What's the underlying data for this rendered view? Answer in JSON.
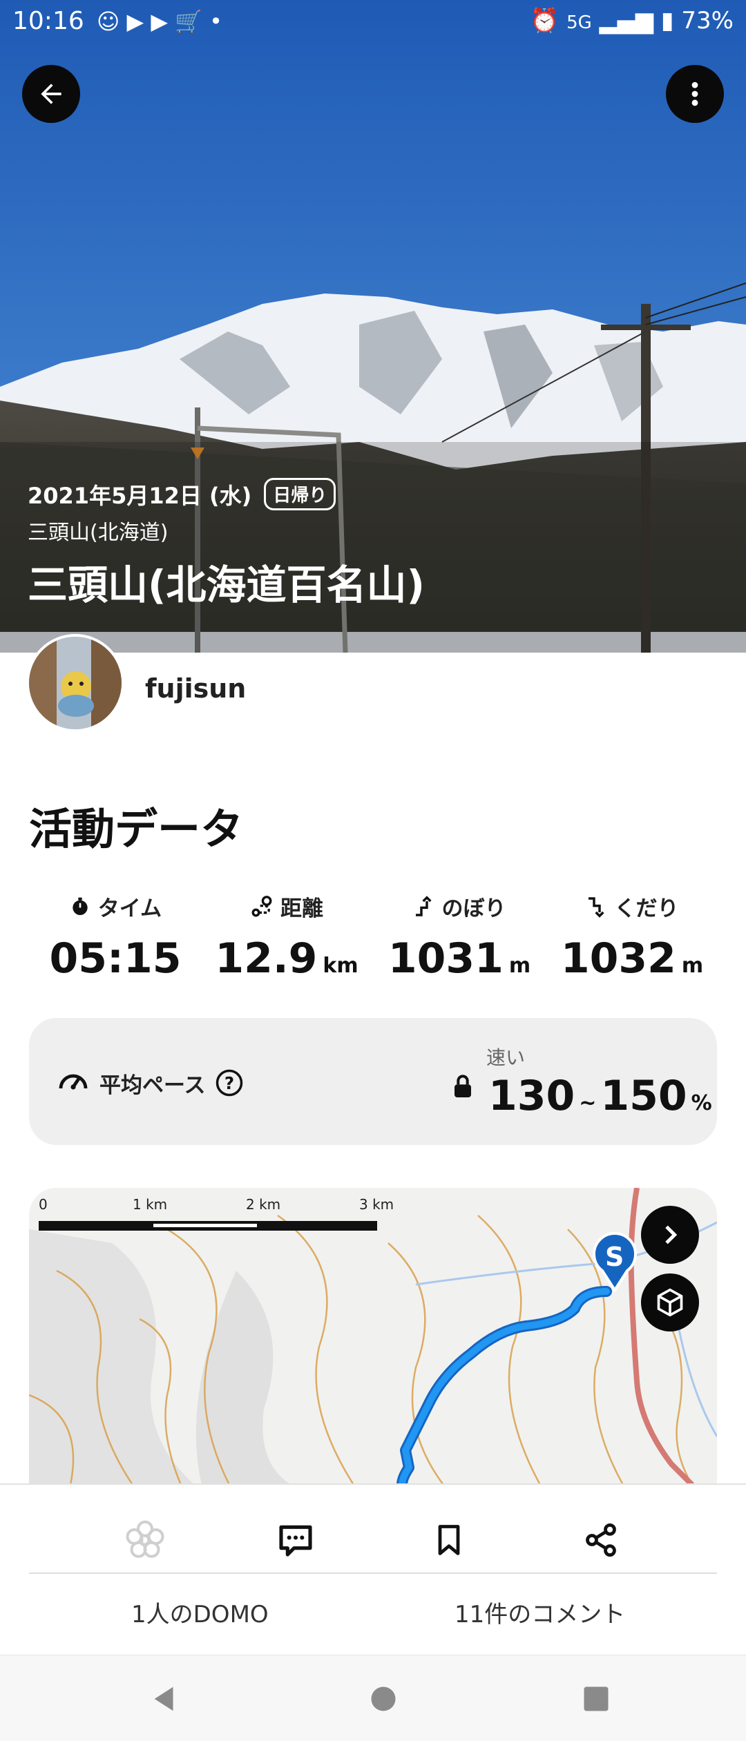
{
  "status_bar": {
    "time": "10:16",
    "network": "5G",
    "battery": "73%",
    "icons": [
      "notification-app-icon",
      "youtube-icon",
      "youtube-icon",
      "cart-icon",
      "dot-icon",
      "alarm-icon",
      "signal-icon",
      "battery-icon"
    ]
  },
  "header": {
    "date": "2021年5月12日 (水)",
    "badge": "日帰り",
    "subtitle": "三頭山(北海道)",
    "title": "三頭山(北海道百名山)"
  },
  "user": {
    "name": "fujisun"
  },
  "activity": {
    "section_title": "活動データ",
    "stats": [
      {
        "label": "タイム",
        "value": "05:15",
        "unit": "",
        "icon": "stopwatch-icon"
      },
      {
        "label": "距離",
        "value": "12.9",
        "unit": "km",
        "icon": "route-icon"
      },
      {
        "label": "のぼり",
        "value": "1031",
        "unit": "m",
        "icon": "ascent-icon"
      },
      {
        "label": "くだり",
        "value": "1032",
        "unit": "m",
        "icon": "descent-icon"
      }
    ],
    "pace": {
      "label": "平均ペース",
      "speed_label": "速い",
      "min": "130",
      "sep": "~",
      "max": "150",
      "unit": "%"
    }
  },
  "map": {
    "scale_labels": [
      "0",
      "1 km",
      "2 km",
      "3 km"
    ],
    "start_marker": "S",
    "route_color": "#1e88e5",
    "contour_color": "#d9a04a",
    "road_color": "#d47a73"
  },
  "bottom": {
    "domo": "1人のDOMO",
    "comments": "11件のコメント"
  },
  "colors": {
    "sky": "#2f6fc2",
    "pace_bg": "#efefef",
    "button_bg": "#0a0a0a"
  }
}
